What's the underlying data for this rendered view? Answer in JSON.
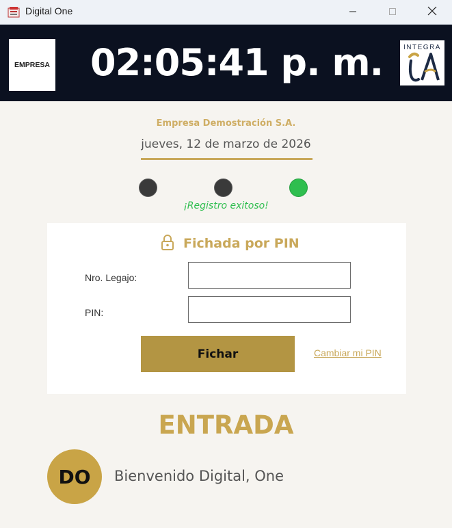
{
  "window": {
    "title": "Digital One",
    "app_icon": "app-icon",
    "controls": [
      "minimize-icon",
      "maximize-icon",
      "close-icon"
    ]
  },
  "header": {
    "company_logo_text": "EMPRESA",
    "clock": "02:05:41 p. m.",
    "brand_logo_text": "INTEGRA",
    "brand_logo_mark": "iA"
  },
  "company": {
    "name": "Empresa Demostración S.A.",
    "date": "jueves, 12 de marzo de 2026"
  },
  "status": {
    "indicators": [
      {
        "state": "inactive",
        "color": "#3a3a3a"
      },
      {
        "state": "inactive",
        "color": "#3a3a3a"
      },
      {
        "state": "success",
        "color": "#2fbe4f"
      }
    ],
    "message": "¡Registro exitoso!"
  },
  "pin_form": {
    "icon": "lock-icon",
    "title": "Fichada por PIN",
    "legajo_label": "Nro. Legajo:",
    "legajo_value": "",
    "pin_label": "PIN:",
    "pin_value": "",
    "submit_label": "Fichar",
    "change_pin_link": "Cambiar mi PIN"
  },
  "result": {
    "type": "ENTRADA",
    "avatar_initials": "DO",
    "welcome_message": "Bienvenido Digital, One"
  },
  "colors": {
    "accent_gold": "#c9a85a",
    "button_gold": "#b39543",
    "success_green": "#2fbe4f",
    "header_dark": "#0b1120"
  }
}
